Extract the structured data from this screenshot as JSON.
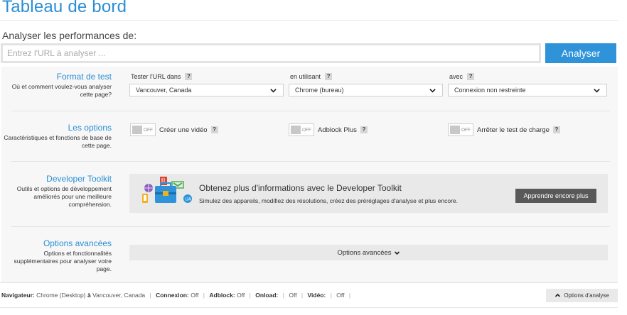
{
  "page": {
    "title": "Tableau de bord"
  },
  "analyze": {
    "label": "Analyser les performances de:",
    "placeholder": "Entrez l'URL à analyser ...",
    "value": "",
    "button": "Analyser"
  },
  "sections": {
    "test_format": {
      "title": "Format de test",
      "desc": "Où et comment voulez-vous analyser cette page?",
      "location_label": "Tester l'URL dans",
      "location_value": "Vancouver, Canada",
      "browser_label": "en utilisant",
      "browser_value": "Chrome (bureau)",
      "connection_label": "avec",
      "connection_value": "Connexion non restreinte"
    },
    "options": {
      "title": "Les options",
      "desc": "Caractéristiques et fonctions de base de cette page.",
      "toggles": [
        {
          "label": "Créer une vidéo",
          "state": "OFF"
        },
        {
          "label": "Adblock Plus",
          "state": "OFF"
        },
        {
          "label": "Arrêter le test de charge",
          "state": "OFF"
        }
      ]
    },
    "toolkit": {
      "title": "Developer Toolkit",
      "desc": "Outils et options de développement améliorés pour une meilleure compréhension.",
      "promo_title": "Obtenez plus d'informations avec le Developer Toolkit",
      "promo_desc": "Simulez des appareils, modifiez des résolutions, créez des préréglages d'analyse et plus encore.",
      "promo_button": "Apprendre encore plus"
    },
    "advanced": {
      "title": "Options avancées",
      "desc": "Options et fonctionnalités supplémentaires pour analyser votre page.",
      "bar_label": "Options avancées"
    }
  },
  "help_mark": "?",
  "status": {
    "browser_key": "Navigateur:",
    "browser_val": "Chrome (Desktop)",
    "at": "à",
    "location_val": "Vancouver, Canada",
    "connection_key": "Connexion:",
    "connection_val": "Off",
    "adblock_key": "Adblock:",
    "adblock_val": "Off",
    "onload_key": "Onload:",
    "onload_val": "Off",
    "video_key": "Vidéo:",
    "video_val": "Off",
    "options_button": "Options d'analyse"
  },
  "colors": {
    "accent": "#2e93d9",
    "panel": "#f7f7f7",
    "promo_bg": "#e9e9e9",
    "promo_button": "#595959"
  },
  "icons": [
    "chevron-down-icon",
    "chevron-up-icon",
    "help-icon",
    "toolkit-illustration"
  ]
}
